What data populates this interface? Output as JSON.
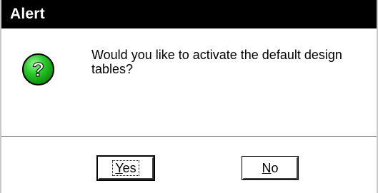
{
  "window": {
    "title": "Alert"
  },
  "dialog": {
    "icon": "question-icon",
    "message": "Would you like to activate the default design tables?"
  },
  "buttons": {
    "yes": {
      "mnemonic": "Y",
      "rest": "es",
      "label": "Yes"
    },
    "no": {
      "mnemonic": "N",
      "rest": "o",
      "label": "No"
    }
  },
  "colors": {
    "titlebar_bg": "#000000",
    "titlebar_text": "#ffffff",
    "icon_green": "#1fb81f"
  }
}
